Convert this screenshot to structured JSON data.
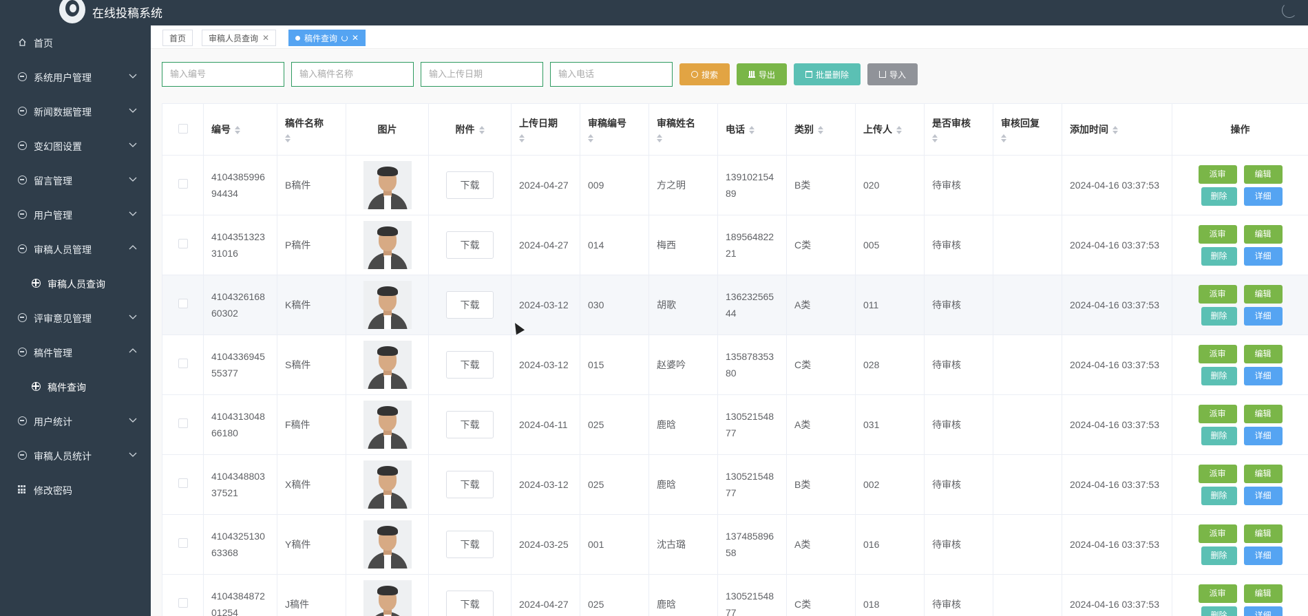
{
  "app": {
    "title": "在线投稿系统"
  },
  "sidebar": {
    "items": [
      {
        "label": "首页",
        "icon": "home-icon",
        "top": 0
      },
      {
        "label": "系统用户管理",
        "icon": "circle-icon",
        "chev": "down"
      },
      {
        "label": "新闻数据管理",
        "icon": "circle-icon",
        "chev": "down"
      },
      {
        "label": "变幻图设置",
        "icon": "circle-icon",
        "chev": "down"
      },
      {
        "label": "留言管理",
        "icon": "circle-icon",
        "chev": "down"
      },
      {
        "label": "用户管理",
        "icon": "circle-icon",
        "chev": "down"
      },
      {
        "label": "审稿人员管理",
        "icon": "circle-icon",
        "chev": "up"
      },
      {
        "label": "审稿人员查询",
        "sub": true
      },
      {
        "label": "评审意见管理",
        "icon": "circle-icon",
        "chev": "down"
      },
      {
        "label": "稿件管理",
        "icon": "circle-icon",
        "chev": "up"
      },
      {
        "label": "稿件查询",
        "sub": true
      },
      {
        "label": "用户统计",
        "icon": "circle-icon",
        "chev": "down"
      },
      {
        "label": "审稿人员统计",
        "icon": "circle-icon",
        "chev": "down"
      },
      {
        "label": "修改密码",
        "icon": "grid-icon"
      }
    ]
  },
  "tabs": [
    {
      "label": "首页",
      "active": false
    },
    {
      "label": "审稿人员查询",
      "active": false,
      "closable": true
    },
    {
      "label": "稿件查询",
      "active": true,
      "closable": true
    }
  ],
  "search": {
    "placeholders": [
      "输入编号",
      "输入稿件名称",
      "输入上传日期",
      "输入电话"
    ],
    "buttons": {
      "search": "搜索",
      "export": "导出",
      "batch_delete": "批量删除",
      "import": "导入"
    }
  },
  "table": {
    "headers": {
      "id": "编号",
      "name": "稿件名称",
      "image": "图片",
      "attachment": "附件",
      "upload_date": "上传日期",
      "reviewer_no": "审稿编号",
      "reviewer_name": "审稿姓名",
      "phone": "电话",
      "category": "类别",
      "uploader": "上传人",
      "reviewed": "是否审核",
      "review_reply": "审核回复",
      "added_time": "添加时间",
      "actions": "操作"
    },
    "download_label": "下载",
    "action_labels": {
      "assign": "派审",
      "edit": "编辑",
      "delete": "删除",
      "detail": "详细"
    },
    "rows": [
      {
        "id": "410438599694434",
        "name": "B稿件",
        "date": "2024-04-27",
        "rno": "009",
        "rname": "方之明",
        "phone": "13910215489",
        "cat": "B类",
        "uploader": "020",
        "reviewed": "待审核",
        "reply": "",
        "added": "2024-04-16 03:37:53"
      },
      {
        "id": "410435132331016",
        "name": "P稿件",
        "date": "2024-04-27",
        "rno": "014",
        "rname": "梅西",
        "phone": "18956482221",
        "cat": "C类",
        "uploader": "005",
        "reviewed": "待审核",
        "reply": "",
        "added": "2024-04-16 03:37:53"
      },
      {
        "id": "410432616860302",
        "name": "K稿件",
        "date": "2024-03-12",
        "rno": "030",
        "rname": "胡歌",
        "phone": "13623256544",
        "cat": "A类",
        "uploader": "011",
        "reviewed": "待审核",
        "reply": "",
        "added": "2024-04-16 03:37:53"
      },
      {
        "id": "410433694555377",
        "name": "S稿件",
        "date": "2024-03-12",
        "rno": "015",
        "rname": "赵婆吟",
        "phone": "13587835380",
        "cat": "C类",
        "uploader": "028",
        "reviewed": "待审核",
        "reply": "",
        "added": "2024-04-16 03:37:53"
      },
      {
        "id": "410431304866180",
        "name": "F稿件",
        "date": "2024-04-11",
        "rno": "025",
        "rname": "鹿晗",
        "phone": "13052154877",
        "cat": "A类",
        "uploader": "031",
        "reviewed": "待审核",
        "reply": "",
        "added": "2024-04-16 03:37:53"
      },
      {
        "id": "410434880337521",
        "name": "X稿件",
        "date": "2024-03-12",
        "rno": "025",
        "rname": "鹿晗",
        "phone": "13052154877",
        "cat": "B类",
        "uploader": "002",
        "reviewed": "待审核",
        "reply": "",
        "added": "2024-04-16 03:37:53"
      },
      {
        "id": "410432513063368",
        "name": "Y稿件",
        "date": "2024-03-25",
        "rno": "001",
        "rname": "沈古璐",
        "phone": "13748589658",
        "cat": "A类",
        "uploader": "016",
        "reviewed": "待审核",
        "reply": "",
        "added": "2024-04-16 03:37:53"
      },
      {
        "id": "410438487201254",
        "name": "J稿件",
        "date": "2024-04-27",
        "rno": "025",
        "rname": "鹿晗",
        "phone": "13052154877",
        "cat": "C类",
        "uploader": "018",
        "reviewed": "待审核",
        "reply": "",
        "added": "2024-04-16 03:37:53"
      }
    ]
  }
}
